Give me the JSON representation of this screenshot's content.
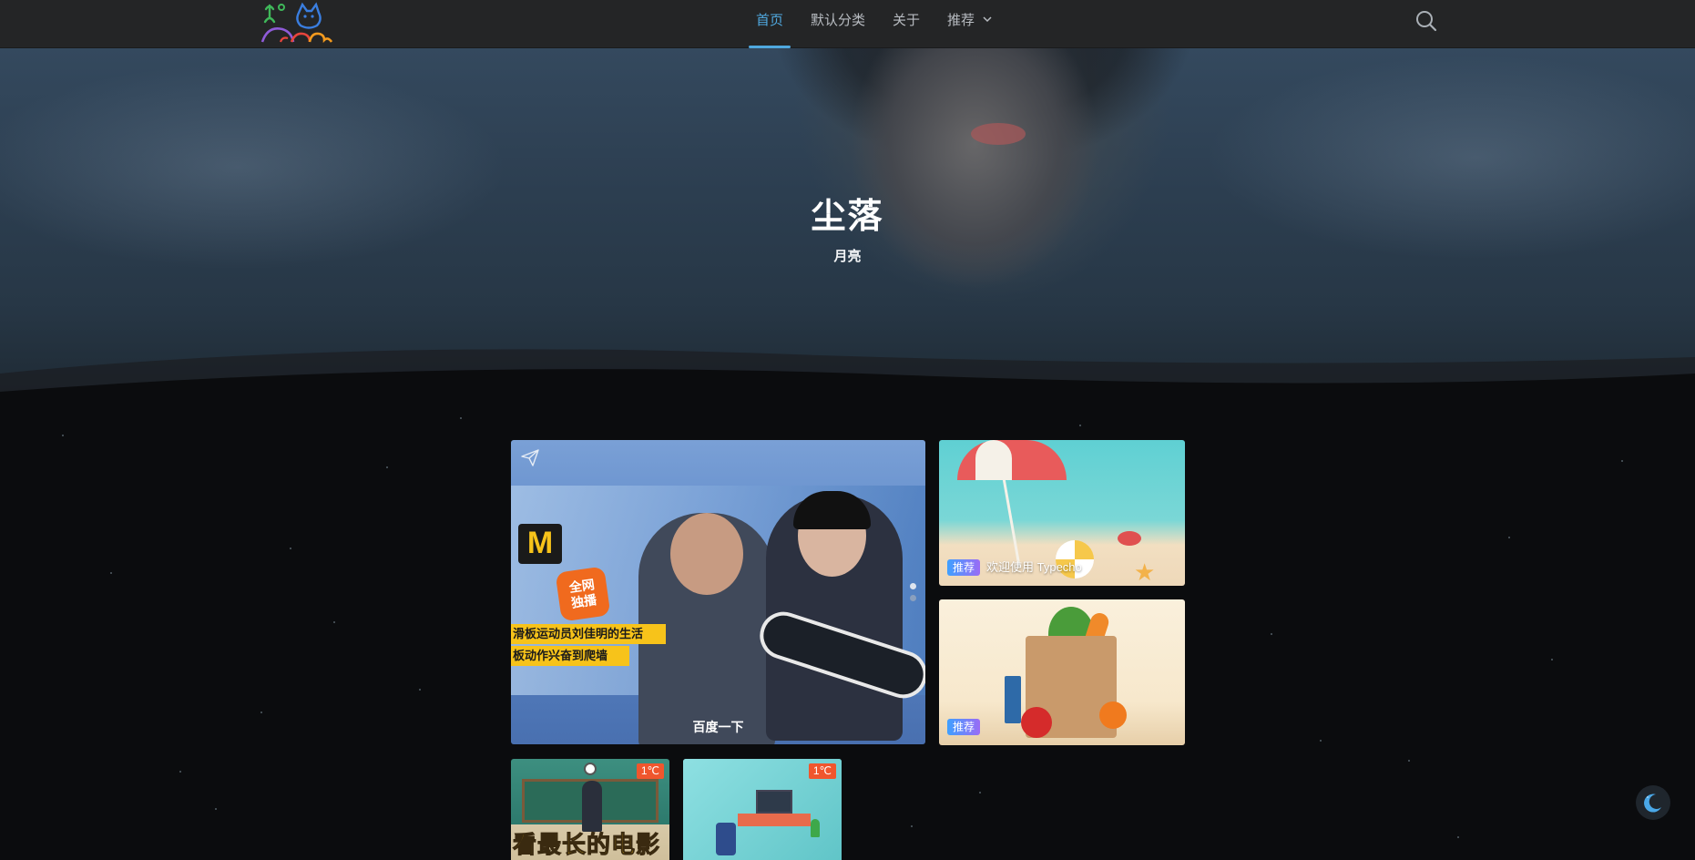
{
  "nav": {
    "items": [
      {
        "label": "首页"
      },
      {
        "label": "默认分类"
      },
      {
        "label": "关于"
      },
      {
        "label": "推荐"
      }
    ]
  },
  "hero": {
    "title": "尘落",
    "subtitle": "月亮"
  },
  "featured": {
    "caption": "百度一下",
    "image_text": {
      "badge": "全网\n独播",
      "strip1": "滑板运动员刘佳明的生活",
      "strip2": "板动作兴奋到爬墙",
      "logo": "M"
    }
  },
  "recommended": [
    {
      "tag": "推荐",
      "title": "欢迎使用 Typecho"
    },
    {
      "tag": "推荐",
      "title": ""
    }
  ],
  "small_cards": [
    {
      "temp": "1℃",
      "image_text": "看最长的电影"
    },
    {
      "temp": "1℃"
    }
  ],
  "colors": {
    "accent": "#4fa8df",
    "nav_bg": "#242526",
    "page_bg": "#0b0c0e",
    "tag_gradient_start": "#3fa0ff",
    "tag_gradient_end": "#9a6cf5",
    "temp_badge": "#f0562d"
  },
  "icons": {
    "logo": "cat-logo-icon",
    "search": "search-icon",
    "dropdown": "chevron-down-icon",
    "share": "paper-plane-icon",
    "theme": "moon-icon"
  }
}
